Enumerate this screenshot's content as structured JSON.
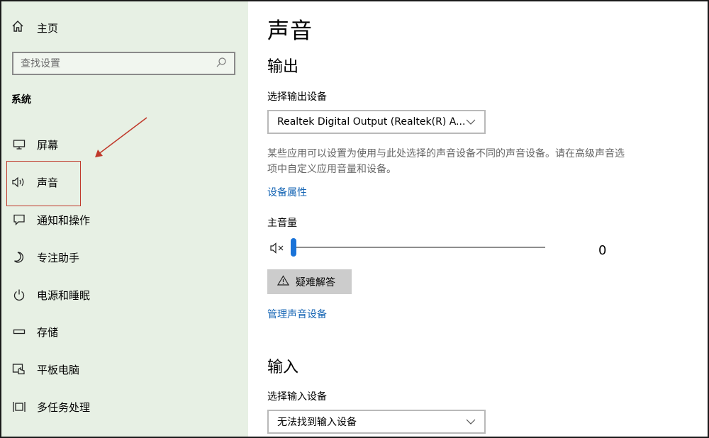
{
  "sidebar": {
    "home_label": "主页",
    "search_placeholder": "查找设置",
    "section_label": "系统",
    "items": [
      {
        "label": "屏幕",
        "icon": "monitor-icon"
      },
      {
        "label": "声音",
        "icon": "speaker-icon"
      },
      {
        "label": "通知和操作",
        "icon": "notification-icon"
      },
      {
        "label": "专注助手",
        "icon": "moon-icon"
      },
      {
        "label": "电源和睡眠",
        "icon": "power-icon"
      },
      {
        "label": "存储",
        "icon": "storage-icon"
      },
      {
        "label": "平板电脑",
        "icon": "tablet-icon"
      },
      {
        "label": "多任务处理",
        "icon": "multitask-icon"
      }
    ],
    "active_item": "声音"
  },
  "main": {
    "title": "声音",
    "output": {
      "heading": "输出",
      "select_label": "选择输出设备",
      "device_value": "Realtek Digital Output (Realtek(R) A...",
      "description": "某些应用可以设置为使用与此处选择的声音设备不同的声音设备。请在高级声音选项中自定义应用音量和设备。",
      "device_properties_link": "设备属性",
      "master_volume_label": "主音量",
      "volume_value": "0",
      "troubleshoot_label": "疑难解答",
      "manage_devices_link": "管理声音设备"
    },
    "input": {
      "heading": "输入",
      "select_label": "选择输入设备",
      "device_value": "无法找到输入设备"
    }
  },
  "colors": {
    "sidebar_bg": "#e7f0e4",
    "link": "#1464b4",
    "slider_thumb": "#1a73d8",
    "annotation": "#c0392b"
  }
}
